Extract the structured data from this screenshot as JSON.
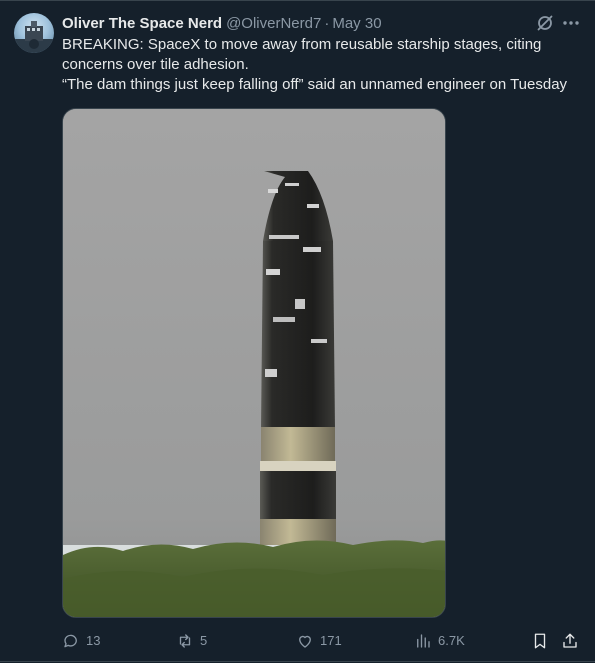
{
  "tweet": {
    "author_name": "Oliver The Space Nerd",
    "handle": "@OliverNerd7",
    "separator": "·",
    "date": "May 30",
    "text_line1": "BREAKING: SpaceX to move away from reusable starship stages, citing concerns over tile adhesion.",
    "text_line2": "“The dam things just keep falling off” said an unnamed engineer on Tuesday"
  },
  "actions": {
    "replies": "13",
    "reposts": "5",
    "likes": "171",
    "views": "6.7K"
  },
  "icons": {
    "header": [
      "grok-icon",
      "more-icon"
    ],
    "actions": [
      "reply-icon",
      "repost-icon",
      "like-icon",
      "views-icon",
      "bookmark-icon",
      "share-icon"
    ]
  },
  "colors": {
    "background": "#15202b",
    "primary_text": "#e7e9ea",
    "secondary_text": "#8b98a5",
    "border": "#38444d"
  }
}
